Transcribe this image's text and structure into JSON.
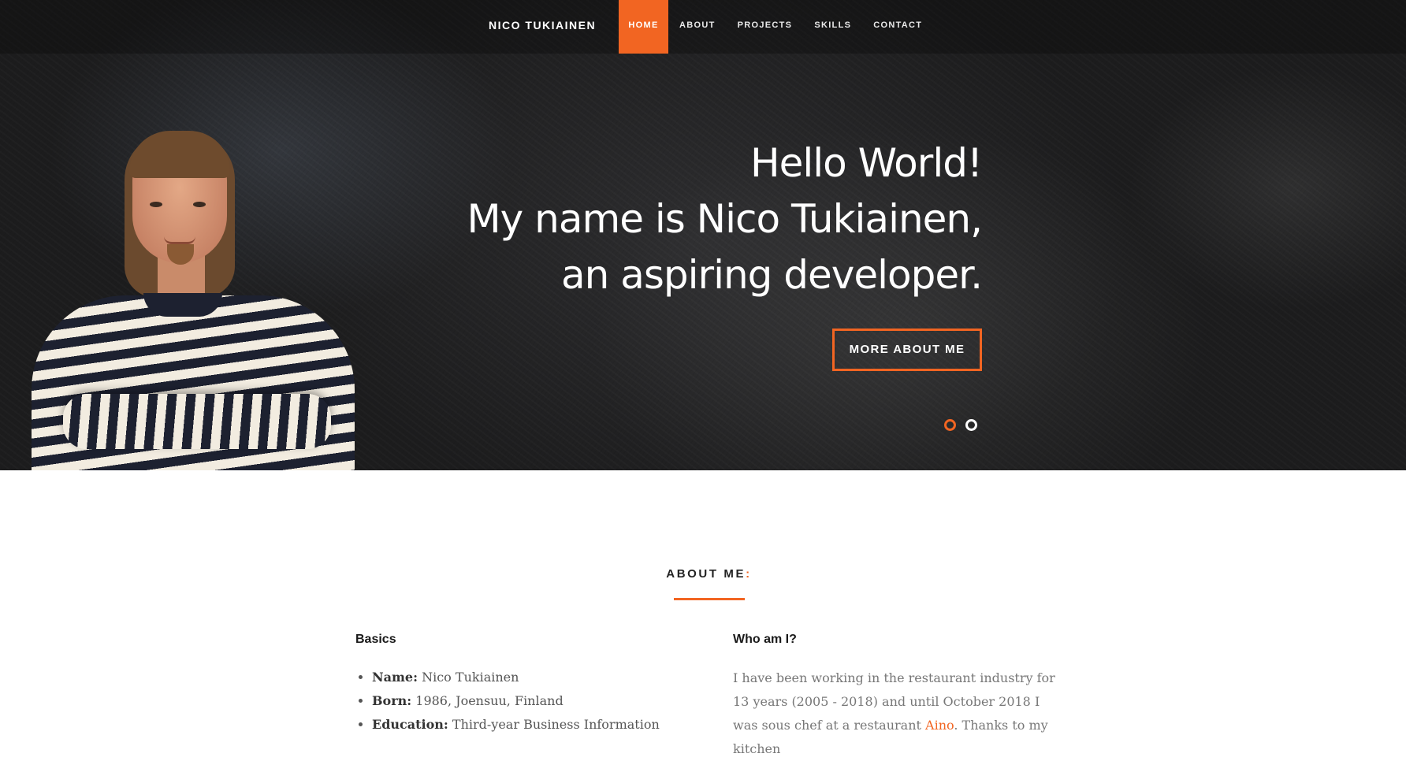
{
  "navbar": {
    "brand": "NICO TUKIAINEN",
    "items": [
      {
        "label": "HOME",
        "active": true
      },
      {
        "label": "ABOUT",
        "active": false
      },
      {
        "label": "PROJECTS",
        "active": false
      },
      {
        "label": "SKILLS",
        "active": false
      },
      {
        "label": "CONTACT",
        "active": false
      }
    ]
  },
  "hero": {
    "line1": "Hello World!",
    "line2": "My name is Nico Tukiainen,",
    "line3": "an aspiring developer.",
    "cta_label": "MORE ABOUT ME",
    "slider": {
      "count": 2,
      "active_index": 0
    }
  },
  "about": {
    "title": "ABOUT ME",
    "title_colon": ":",
    "basics": {
      "heading": "Basics",
      "items": [
        {
          "label": "Name:",
          "value": " Nico Tukiainen"
        },
        {
          "label": "Born:",
          "value": " 1986, Joensuu, Finland"
        },
        {
          "label": "Education:",
          "value": " Third-year Business Information"
        }
      ]
    },
    "who": {
      "heading": "Who am I?",
      "text_before_link": "I have been working in the restaurant industry for 13 years (2005 - 2018) and until October 2018 I was sous chef at a restaurant ",
      "link_text": "Aino",
      "text_after_link": ". Thanks to my kitchen"
    }
  },
  "colors": {
    "accent": "#f26522",
    "hero_bg": "#222223",
    "text_dark": "#1a1a1a",
    "text_body": "#777777"
  }
}
